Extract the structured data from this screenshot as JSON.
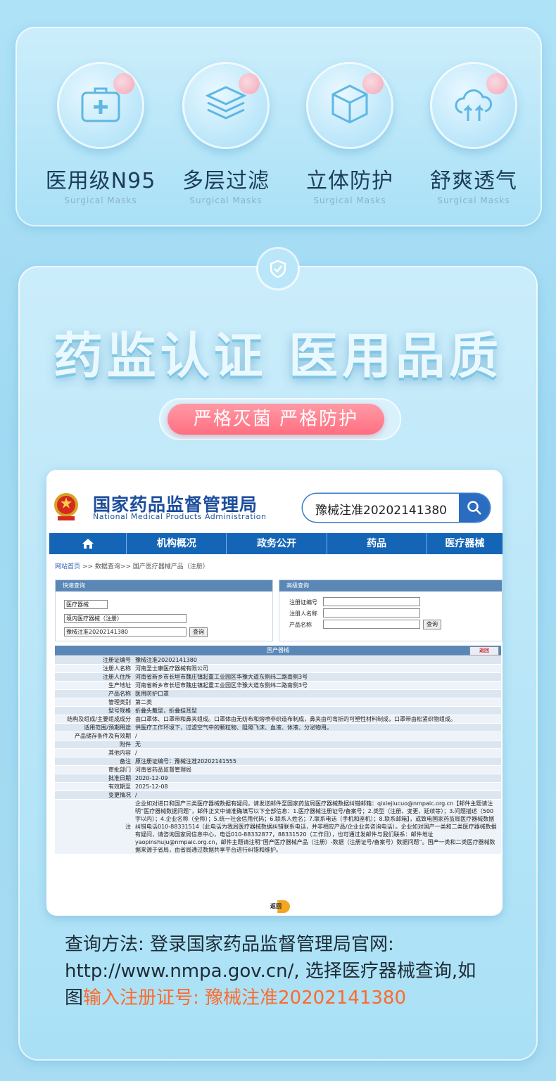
{
  "features": [
    {
      "title": "医用级N95",
      "subtitle": "Surgical Masks",
      "icon": "medical-kit-icon"
    },
    {
      "title": "多层过滤",
      "subtitle": "Surgical Masks",
      "icon": "layers-icon"
    },
    {
      "title": "立体防护",
      "subtitle": "Surgical Masks",
      "icon": "cube-icon"
    },
    {
      "title": "舒爽透气",
      "subtitle": "Surgical Masks",
      "icon": "cloud-airflow-icon"
    }
  ],
  "headline": "药监认证 医用品质",
  "pill": "严格灭菌 严格防护",
  "site": {
    "title": "国家药品监督管理局",
    "subtitle": "National Medical Products Administration",
    "search_value": "豫械注准20202141380",
    "nav": [
      "机构概况",
      "政务公开",
      "药品",
      "医疗器械"
    ],
    "breadcrumb": {
      "home": "网站首页",
      "rest": ">> 数据查询>> 国产医疗器械产品（注册）"
    },
    "quick": {
      "header": "快速查询",
      "select1": "医疗器械",
      "select2": "境内医疗器械（注册）",
      "input": "豫械注准20202141380",
      "button": "查询"
    },
    "advanced": {
      "header": "高级查询",
      "field1": "注册证编号",
      "field2": "注册人名称",
      "field3": "产品名称",
      "button": "查询"
    },
    "table_title": "国产器械",
    "back_label": "返回",
    "rows": [
      {
        "k": "注册证编号",
        "v": "豫械注准20202141380"
      },
      {
        "k": "注册人名称",
        "v": "河南圣士康医疗器械有限公司"
      },
      {
        "k": "注册人住所",
        "v": "河南省新乡市长垣市魏庄镇起重工业园区华豫大道东侧纬二路南侧3号"
      },
      {
        "k": "生产地址",
        "v": "河南省新乡市长垣市魏庄镇起重工业园区华豫大道东侧纬二路南侧3号"
      },
      {
        "k": "产品名称",
        "v": "医用防护口罩"
      },
      {
        "k": "管理类别",
        "v": "第二类"
      },
      {
        "k": "型号规格",
        "v": "折叠头戴型，折叠挂耳型"
      },
      {
        "k": "结构及组成/主要组成成分",
        "v": "由口罩体、口罩带和鼻夹组成。口罩体由无纺布和熔喷非织造布制成，鼻夹由可弯折的可塑性材料制成，口罩带由松紧织物组成。"
      },
      {
        "k": "适用范围/预期用途",
        "v": "供医疗工作环境下，过滤空气中的颗粒物、阻隔飞沫、血液、体液、分泌物用。"
      },
      {
        "k": "产品储存条件及有效期",
        "v": "/"
      },
      {
        "k": "附件",
        "v": "无"
      },
      {
        "k": "其他内容",
        "v": "/"
      },
      {
        "k": "备注",
        "v": "原注册证编号：豫械注准20202141555"
      },
      {
        "k": "审批部门",
        "v": "河南省药品监督管理局"
      },
      {
        "k": "批准日期",
        "v": "2020-12-09"
      },
      {
        "k": "有效期至",
        "v": "2025-12-08"
      },
      {
        "k": "变更情况",
        "v": "/"
      },
      {
        "k": "注",
        "v": "企业如对进口和国产三类医疗器械数据有疑问，请发送邮件至国家药监局医疗器械数据纠错邮箱：qixiejiucuo@nmpaic.org.cn【邮件主题请注明“医疗器械数据问题”，邮件正文中请准确填写以下全部信息：1.医疗器械注册证号/备案号；2.类型（注册、变更、延续等）；3.问题描述（500字以内）；4.企业名称（全称）；5.统一社会信用代码；6.联系人姓名；7.联系电话（手机和座机）；8.联系邮箱】，或致电国家药监局医疗器械数据纠错电话010-88331514（此电话为我局医疗器械数据纠错联系电话，并非相应产品/企业业务咨询电话）。企业如对国产一类和二类医疗器械数据有疑问，请咨询国家局信息中心，电话010-88332877，88331520（工作日），也可通过发邮件与我们联系：邮件地址yaopinshuju@nmpaic.org.cn，邮件主题请注明“国产医疗器械产品（注册）-数据（注册证号/备案号）数据问题”。国产一类和二类医疗器械数据来源于省局，由省局通过数据共享平台进行纠错和维护。"
      }
    ],
    "back_bottom": "返回"
  },
  "caption": {
    "line": "查询方法: 登录国家药品监督管理局官网: http://www.nmpa.gov.cn/, 选择医疗器械查询,如图",
    "highlight": "输入注册证号: 豫械注准20202141380"
  },
  "colors": {
    "accent": "#ff6a2b",
    "nav": "#1565b7",
    "pill": "#ff7a8b"
  }
}
